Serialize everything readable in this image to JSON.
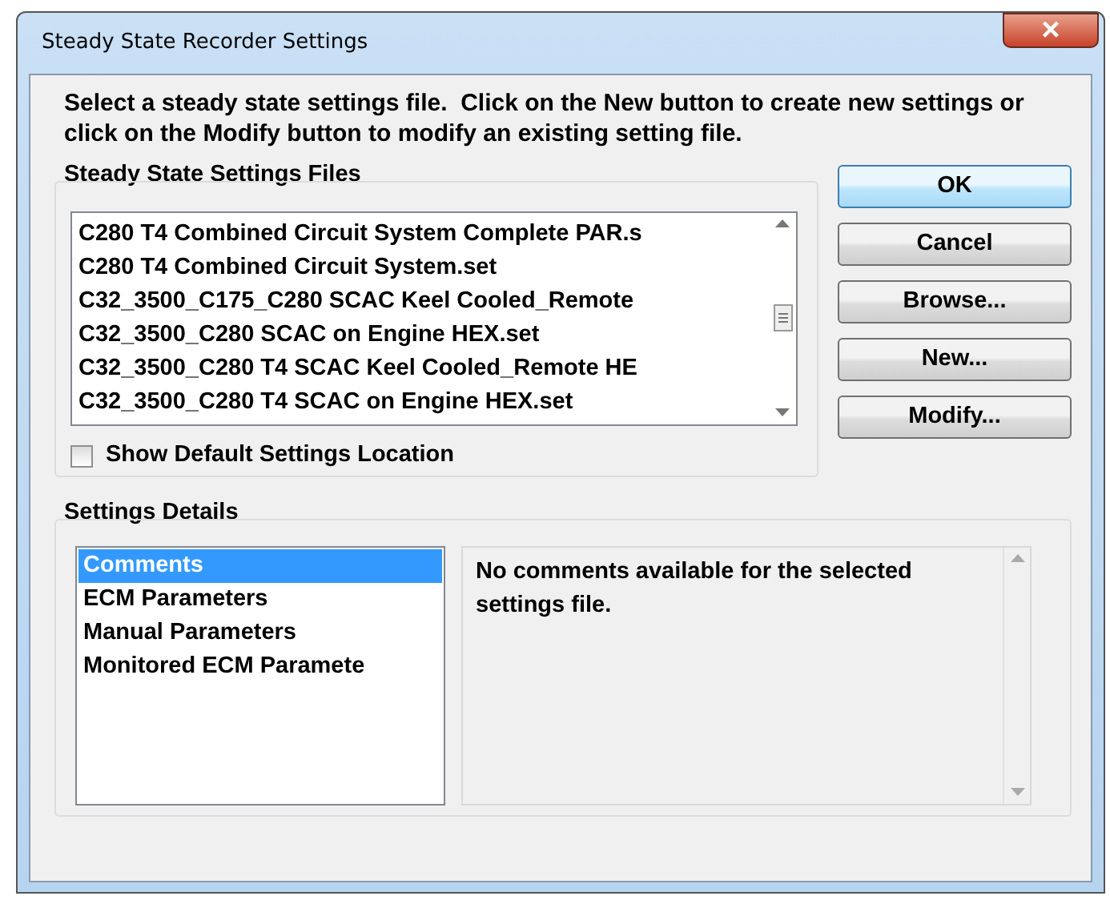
{
  "window": {
    "title": "Steady State Recorder Settings",
    "close": "×"
  },
  "instructions": "Select a steady state settings file.  Click on the New button to create new settings or click on the Modify button to modify an existing setting file.",
  "files_group": {
    "label": "Steady State Settings Files",
    "files": [
      {
        "name": "C280 T4 Combined Circuit System Complete PAR.s",
        "selected": false
      },
      {
        "name": "C280 T4 Combined Circuit System.set",
        "selected": false
      },
      {
        "name": "C32_3500_C175_C280 SCAC Keel Cooled_Remote",
        "selected": false
      },
      {
        "name": "C32_3500_C280 SCAC on Engine HEX.set",
        "selected": false
      },
      {
        "name": "C32_3500_C280 T4 SCAC Keel Cooled_Remote HE",
        "selected": false
      },
      {
        "name": "C32_3500_C280 T4 SCAC on Engine HEX.set",
        "selected": false
      }
    ],
    "show_default_location": {
      "label": "Show Default Settings Location",
      "checked": false
    }
  },
  "buttons": [
    {
      "label": "OK",
      "default": true
    },
    {
      "label": "Cancel",
      "default": false
    },
    {
      "label": "Browse...",
      "default": false
    },
    {
      "label": "New...",
      "default": false
    },
    {
      "label": "Modify...",
      "default": false
    }
  ],
  "details_group": {
    "label": "Settings Details",
    "sections": [
      {
        "name": "Comments",
        "selected": true
      },
      {
        "name": "ECM Parameters",
        "selected": false
      },
      {
        "name": "Manual Parameters",
        "selected": false
      },
      {
        "name": "Monitored ECM Paramete",
        "selected": false
      }
    ],
    "comments": "No comments available for the selected settings file."
  }
}
